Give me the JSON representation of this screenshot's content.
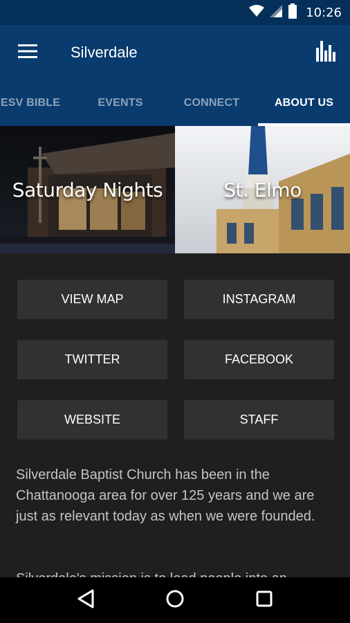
{
  "status_bar": {
    "time": "10:26"
  },
  "app_bar": {
    "title": "Silverdale"
  },
  "tabs": [
    {
      "label": "ESV BIBLE"
    },
    {
      "label": "EVENTS"
    },
    {
      "label": "CONNECT"
    },
    {
      "label": "ABOUT US"
    }
  ],
  "banners": [
    {
      "label": "Saturday Nights"
    },
    {
      "label": "St. Elmo"
    }
  ],
  "buttons": {
    "view_map": "VIEW MAP",
    "instagram": "INSTAGRAM",
    "twitter": "TWITTER",
    "facebook": "FACEBOOK",
    "website": "WEBSITE",
    "staff": "STAFF"
  },
  "about": {
    "paragraph1": "Silverdale Baptist Church has been in the Chattanooga area for over 125 years and we are just as relevant today as when we were founded.",
    "paragraph2": "Silverdale's mission is to lead people into an"
  },
  "colors": {
    "status_bar": "#04305a",
    "app_bar": "#093b6e",
    "background": "#1f1f20",
    "button": "#303132"
  }
}
